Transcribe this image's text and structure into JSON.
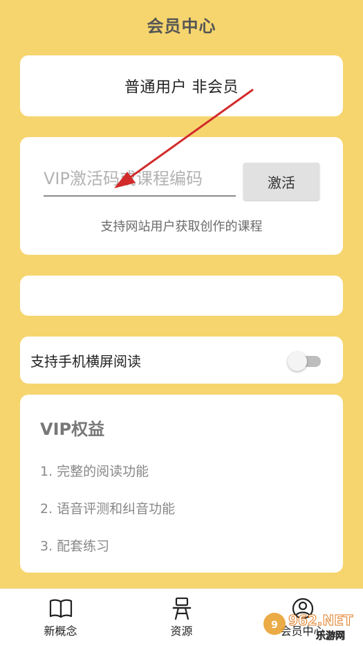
{
  "header": {
    "title": "会员中心"
  },
  "user_status": {
    "text": "普通用户 非会员"
  },
  "activation": {
    "input_placeholder": "VIP激活码或课程编码",
    "input_value": "",
    "button_label": "激活",
    "hint": "支持网站用户获取创作的课程"
  },
  "landscape": {
    "label": "支持手机横屏阅读",
    "enabled": false
  },
  "vip": {
    "title": "VIP权益",
    "benefits": [
      "1. 完整的阅读功能",
      "2. 语音评测和纠音功能",
      "3. 配套练习"
    ]
  },
  "bottom_nav": {
    "items": [
      {
        "label": "新概念",
        "icon": "book-icon"
      },
      {
        "label": "资源",
        "icon": "desk-icon"
      },
      {
        "label": "会员中心",
        "icon": "user-icon"
      }
    ]
  },
  "watermark": {
    "text": "962.NET",
    "subtext": "乐游网"
  },
  "colors": {
    "background": "#F6D56E",
    "card": "#FFFFFF",
    "annotation_arrow": "#D22A2A"
  }
}
